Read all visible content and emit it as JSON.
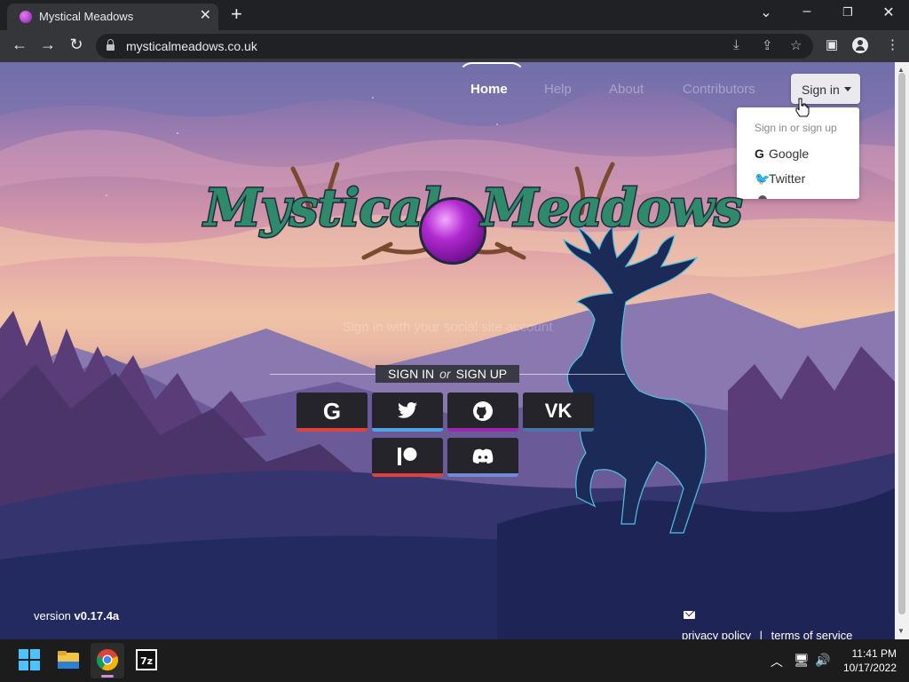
{
  "browser": {
    "tab_title": "Mystical Meadows",
    "url": "mysticalmeadows.co.uk"
  },
  "nav": {
    "items": [
      "Home",
      "Help",
      "About",
      "Contributors"
    ],
    "signin_label": "Sign in"
  },
  "dropdown": {
    "header": "Sign in or sign up",
    "items": [
      "Google",
      "Twitter"
    ]
  },
  "logo": {
    "left_word": "Mystical",
    "right_word": "Meadows"
  },
  "tagline": "Sign in with your social site account",
  "signup_bar": {
    "sign_in": "SIGN IN",
    "or": "or",
    "sign_up": "SIGN UP"
  },
  "social_buttons": [
    {
      "name": "google",
      "icon": "G",
      "accent": "#e0413a"
    },
    {
      "name": "twitter",
      "icon": "🐦",
      "accent": "#4fa3e0"
    },
    {
      "name": "github",
      "icon": "github",
      "accent": "#9b27b0"
    },
    {
      "name": "vk",
      "icon": "VK",
      "accent": "#4a76a8"
    },
    {
      "name": "patreon",
      "icon": "patreon",
      "accent": "#e0413a"
    },
    {
      "name": "discord",
      "icon": "discord",
      "accent": "#7289da"
    }
  ],
  "footer": {
    "version_prefix": "version",
    "version": "v0.17.4a",
    "privacy": "privacy policy",
    "separator": "|",
    "terms": "terms of service"
  },
  "taskbar": {
    "time": "11:41 PM",
    "date": "10/17/2022"
  }
}
